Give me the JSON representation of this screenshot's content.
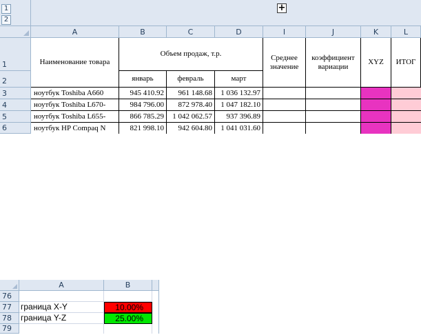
{
  "outline": {
    "levels": [
      "1",
      "2"
    ],
    "expand_symbol": "+"
  },
  "columns": [
    "A",
    "B",
    "C",
    "D",
    "I",
    "J",
    "K",
    "L"
  ],
  "rows": [
    "1",
    "2",
    "3",
    "4",
    "5",
    "6"
  ],
  "header": {
    "name": "Наименование товара",
    "sales_group": "Объем продаж, т.р.",
    "months": [
      "январь",
      "февраль",
      "март"
    ],
    "average": "Среднее значение",
    "variation": "коэффициент вариации",
    "xyz": "XYZ",
    "total": "ИТОГ"
  },
  "data_rows": [
    {
      "row": "3",
      "name": "ноутбук Toshiba A660",
      "jan": "945 410.92",
      "feb": "961 148.68",
      "mar": "1 036 132.97"
    },
    {
      "row": "4",
      "name": "ноутбук Toshiba L670-",
      "jan": "984 796.00",
      "feb": "872 978.40",
      "mar": "1 047 182.10"
    },
    {
      "row": "5",
      "name": "ноутбук Toshiba L655-",
      "jan": "866 785.29",
      "feb": "1 042 062.57",
      "mar": "937 396.89"
    },
    {
      "row": "6",
      "name": "ноутбук HP Compaq N",
      "jan": "821 998.10",
      "feb": "942 604.80",
      "mar": "1 041 031.60"
    }
  ],
  "colors": {
    "xyz_fill": "#e833c0",
    "total_fill": "#ffccd6",
    "header_bg": "#dfe7f2",
    "red": "#ff0000",
    "green": "#00e800"
  },
  "lower": {
    "columns": [
      "A",
      "B"
    ],
    "rows": [
      {
        "num": "76",
        "a": "",
        "b": ""
      },
      {
        "num": "77",
        "a": "граница X-Y",
        "b": "10.00%"
      },
      {
        "num": "78",
        "a": "граница Y-Z",
        "b": "25.00%"
      },
      {
        "num": "79",
        "a": "",
        "b": ""
      }
    ]
  }
}
